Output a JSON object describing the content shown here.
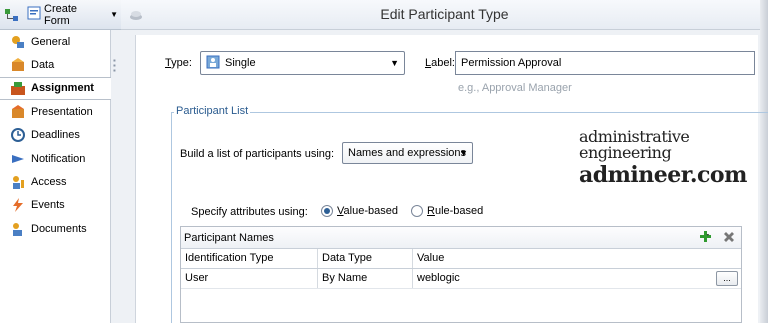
{
  "toolbar": {
    "create_form_label": "Create Form"
  },
  "nav": {
    "items": [
      {
        "label": "General",
        "icon": "general-icon"
      },
      {
        "label": "Data",
        "icon": "data-icon"
      },
      {
        "label": "Assignment",
        "icon": "assignment-icon",
        "active": true
      },
      {
        "label": "Presentation",
        "icon": "presentation-icon"
      },
      {
        "label": "Deadlines",
        "icon": "deadlines-icon"
      },
      {
        "label": "Notification",
        "icon": "notification-icon"
      },
      {
        "label": "Access",
        "icon": "access-icon"
      },
      {
        "label": "Events",
        "icon": "events-icon"
      },
      {
        "label": "Documents",
        "icon": "documents-icon"
      }
    ]
  },
  "header": {
    "title": "Edit Participant Type"
  },
  "form": {
    "type_label_first": "T",
    "type_label_rest": "ype:",
    "type_value": "Single",
    "label_label_first": "L",
    "label_label_rest": "abel:",
    "label_value": "Permission Approval",
    "label_hint": "e.g., Approval Manager",
    "participant_list_legend": "Participant List",
    "build_label": "Build a list of participants using:",
    "build_value": "Names and expressions",
    "specify_label": "Specify attributes using:",
    "radio_value_based_first": "V",
    "radio_value_based_rest": "alue-based",
    "radio_rule_based_first": "R",
    "radio_rule_based_rest": "ule-based"
  },
  "watermark": {
    "line1": "administrative engineering",
    "line2": "admineer.com"
  },
  "table": {
    "title": "Participant Names",
    "columns": [
      "Identification Type",
      "Data Type",
      "Value"
    ],
    "rows": [
      [
        "User",
        "By Name",
        "weblogic"
      ]
    ],
    "browse_label": "..."
  },
  "colors": {
    "accent": "#2d5f95",
    "legend": "#2a5b8f",
    "hint": "#9aa3ad"
  }
}
